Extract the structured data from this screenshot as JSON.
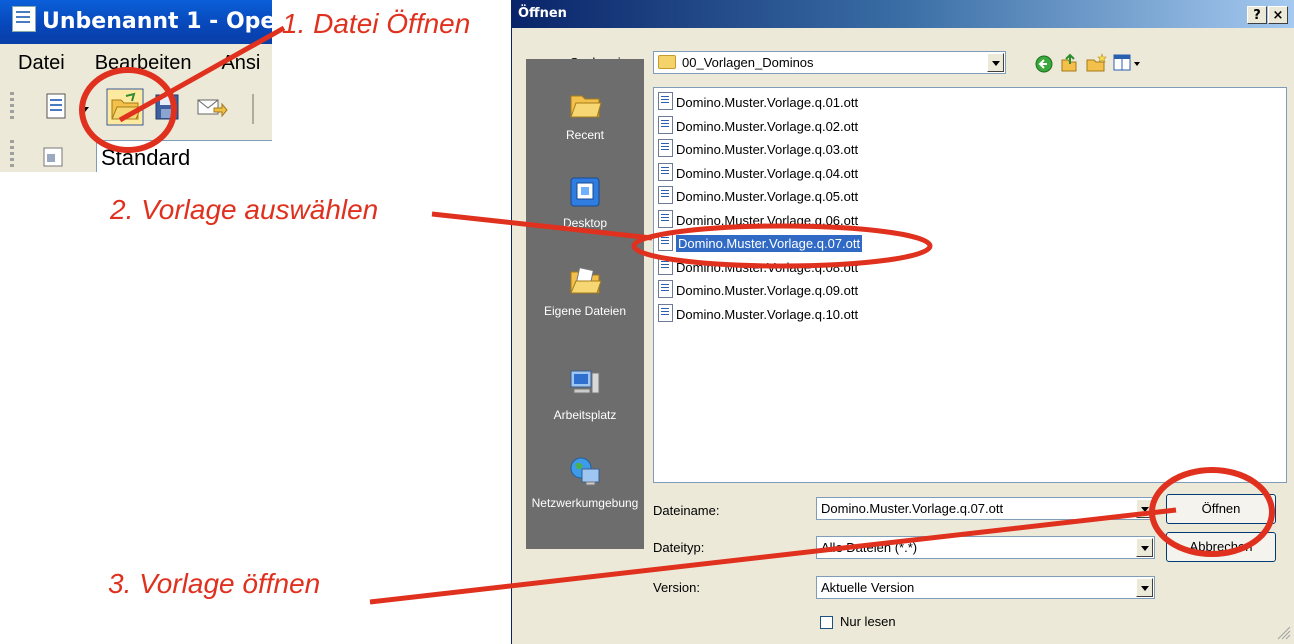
{
  "app": {
    "title": "Unbenannt 1 - Oper",
    "menu": [
      "Datei",
      "Bearbeiten",
      "Ansi"
    ],
    "style_value": "Standard"
  },
  "dialog": {
    "title": "Öffnen",
    "help_label": "?",
    "close_label": "×",
    "look_in_label": "Suchen in:",
    "look_in_value": "00_Vorlagen_Dominos",
    "places": [
      {
        "label": "Recent",
        "icon": "recent-folder-icon"
      },
      {
        "label": "Desktop",
        "icon": "desktop-icon"
      },
      {
        "label": "Eigene Dateien",
        "icon": "my-documents-icon"
      },
      {
        "label": "Arbeitsplatz",
        "icon": "my-computer-icon"
      },
      {
        "label": "Netzwerkumgebung",
        "icon": "network-icon"
      }
    ],
    "files": [
      "Domino.Muster.Vorlage.q.01.ott",
      "Domino.Muster.Vorlage.q.02.ott",
      "Domino.Muster.Vorlage.q.03.ott",
      "Domino.Muster.Vorlage.q.04.ott",
      "Domino.Muster.Vorlage.q.05.ott",
      "Domino.Muster.Vorlage.q.06.ott",
      "Domino.Muster.Vorlage.q.07.ott",
      "Domino.Muster.Vorlage.q.08.ott",
      "Domino.Muster.Vorlage.q.09.ott",
      "Domino.Muster.Vorlage.q.10.ott"
    ],
    "selected_file_index": 6,
    "filename_label": "Dateiname:",
    "filename_value": "Domino.Muster.Vorlage.q.07.ott",
    "filetype_label": "Dateityp:",
    "filetype_value": "Alle Dateien (*.*)",
    "version_label": "Version:",
    "version_value": "Aktuelle Version",
    "readonly_label": "Nur lesen",
    "readonly_checked": false,
    "open_button": "Öffnen",
    "cancel_button": "Abbrechen"
  },
  "annotations": {
    "step1": "1. Datei Öffnen",
    "step2": "2. Vorlage auswählen",
    "step3": "3. Vorlage öffnen"
  },
  "colors": {
    "annotation": "#e0301e",
    "selection": "#316ac5",
    "places_bar": "#6d6d6d"
  }
}
